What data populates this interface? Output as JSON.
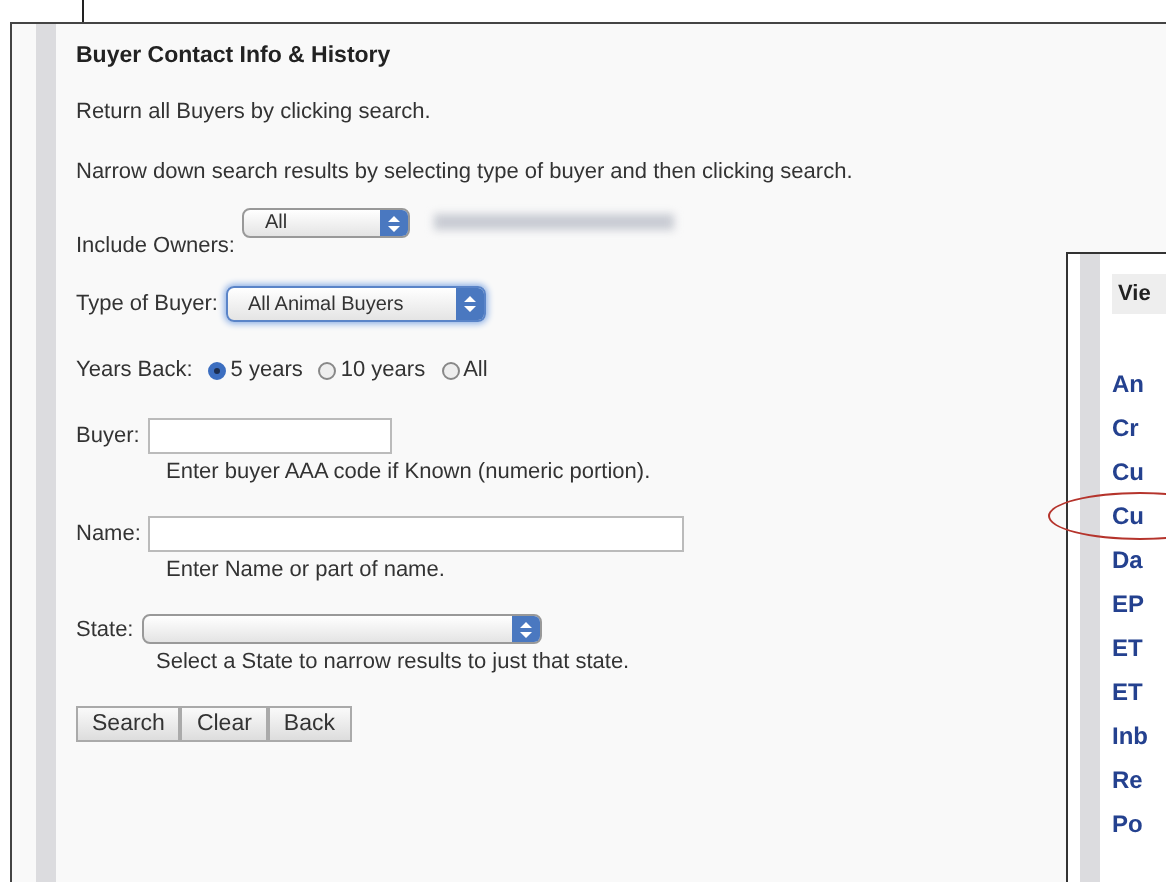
{
  "panel": {
    "title": "Buyer Contact Info & History",
    "intro": "Return all Buyers by clicking search.",
    "instructions": "Narrow down search results by selecting type of buyer and then clicking search.",
    "owners": {
      "label": "Include Owners:",
      "value": "All"
    },
    "buyer_type": {
      "label": "Type of Buyer:",
      "value": "All Animal Buyers",
      "focused": true
    },
    "years_back": {
      "label": "Years Back:",
      "options": [
        {
          "label": "5 years",
          "selected": true
        },
        {
          "label": "10 years",
          "selected": false
        },
        {
          "label": "All",
          "selected": false
        }
      ]
    },
    "buyer": {
      "label": "Buyer:",
      "hint": "Enter buyer AAA code if Known (numeric portion)."
    },
    "name": {
      "label": "Name:",
      "hint": "Enter Name or part of name."
    },
    "state": {
      "label": "State:",
      "hint": "Select a State to narrow results to just that state."
    },
    "buttons": [
      "Search",
      "Clear",
      "Back"
    ]
  },
  "side_panel": {
    "header": "Vie",
    "items": [
      {
        "label": "An",
        "circled": false
      },
      {
        "label": "Cr",
        "circled": false
      },
      {
        "label": "Cu",
        "circled": false
      },
      {
        "label": "Cu",
        "circled": true
      },
      {
        "label": "Da",
        "circled": false
      },
      {
        "label": "EP",
        "circled": false
      },
      {
        "label": "ET",
        "circled": false
      },
      {
        "label": "ET",
        "circled": false
      },
      {
        "label": "Inb",
        "circled": false
      },
      {
        "label": "Re",
        "circled": false
      },
      {
        "label": "Po",
        "circled": false
      }
    ]
  }
}
